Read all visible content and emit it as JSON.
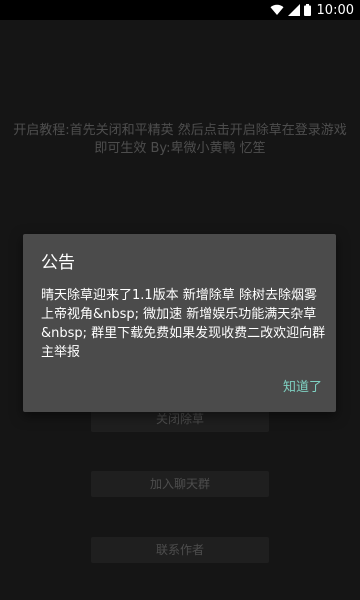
{
  "status_bar": {
    "time": "10:00",
    "icons": [
      "wifi-icon",
      "signal-icon",
      "battery-icon"
    ]
  },
  "main": {
    "instruction": "开启教程:首先关闭和平精英 然后点击开启除草在登录游戏即可生效 By:卑微小黄鸭 忆笙",
    "buttons": {
      "close_weed": "关闭除草",
      "join_group": "加入聊天群",
      "contact_author": "联系作者"
    }
  },
  "dialog": {
    "title": "公告",
    "body": "晴天除草迎来了1.1版本 新增除草 除树去除烟雾 上帝视角&nbsp; 微加速 新增娱乐功能满天杂草&nbsp; 群里下载免费如果发现收费二改欢迎向群主举报",
    "confirm": "知道了"
  },
  "colors": {
    "background": "#222222",
    "dialog": "#4b4b4b",
    "accent": "#7fd1c2",
    "muted_text": "#7d7d7d"
  }
}
